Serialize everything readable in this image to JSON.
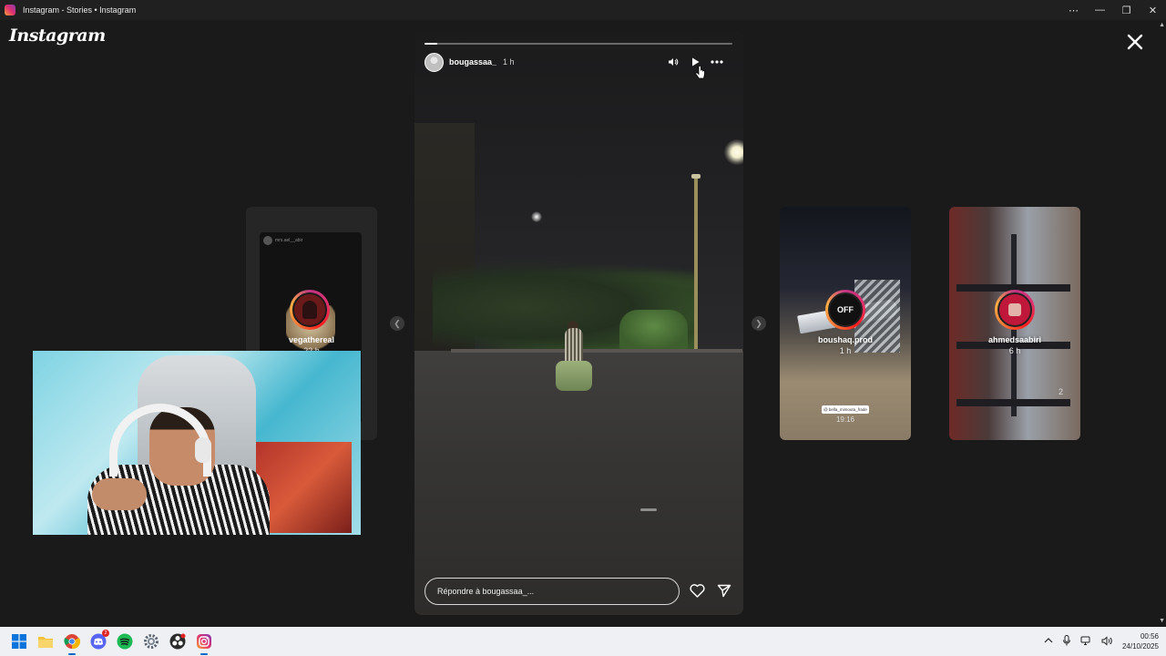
{
  "window": {
    "title": "Instagram - Stories • Instagram",
    "controls": [
      "⋯",
      "—",
      "❐",
      "✕"
    ]
  },
  "header": {
    "logo_text": "Instagram"
  },
  "current_story": {
    "username": "bougassaa_",
    "time": "1 h",
    "progress": 0.04,
    "reply_placeholder": "Répondre à bougassaa_..."
  },
  "side_stories": [
    {
      "username": "vegathereal",
      "time": "22 h",
      "mini_user": "mrs.ael__abir",
      "badge": ""
    },
    {
      "username": "boushaq.prod",
      "time": "1 h",
      "badge": "OFF",
      "sticker": "@ bella_mimouta_frade",
      "sticker_time": "19:16"
    },
    {
      "username": "ahmedsaabiri",
      "time": "6 h",
      "badge": "",
      "mark": "2"
    }
  ],
  "taskbar": {
    "apps": [
      "windows-start",
      "file-explorer",
      "chrome",
      "discord",
      "spotify",
      "settings",
      "obs",
      "instagram"
    ],
    "discord_badge": "2",
    "clock_time": "00:56",
    "clock_date": "24/10/2025"
  }
}
